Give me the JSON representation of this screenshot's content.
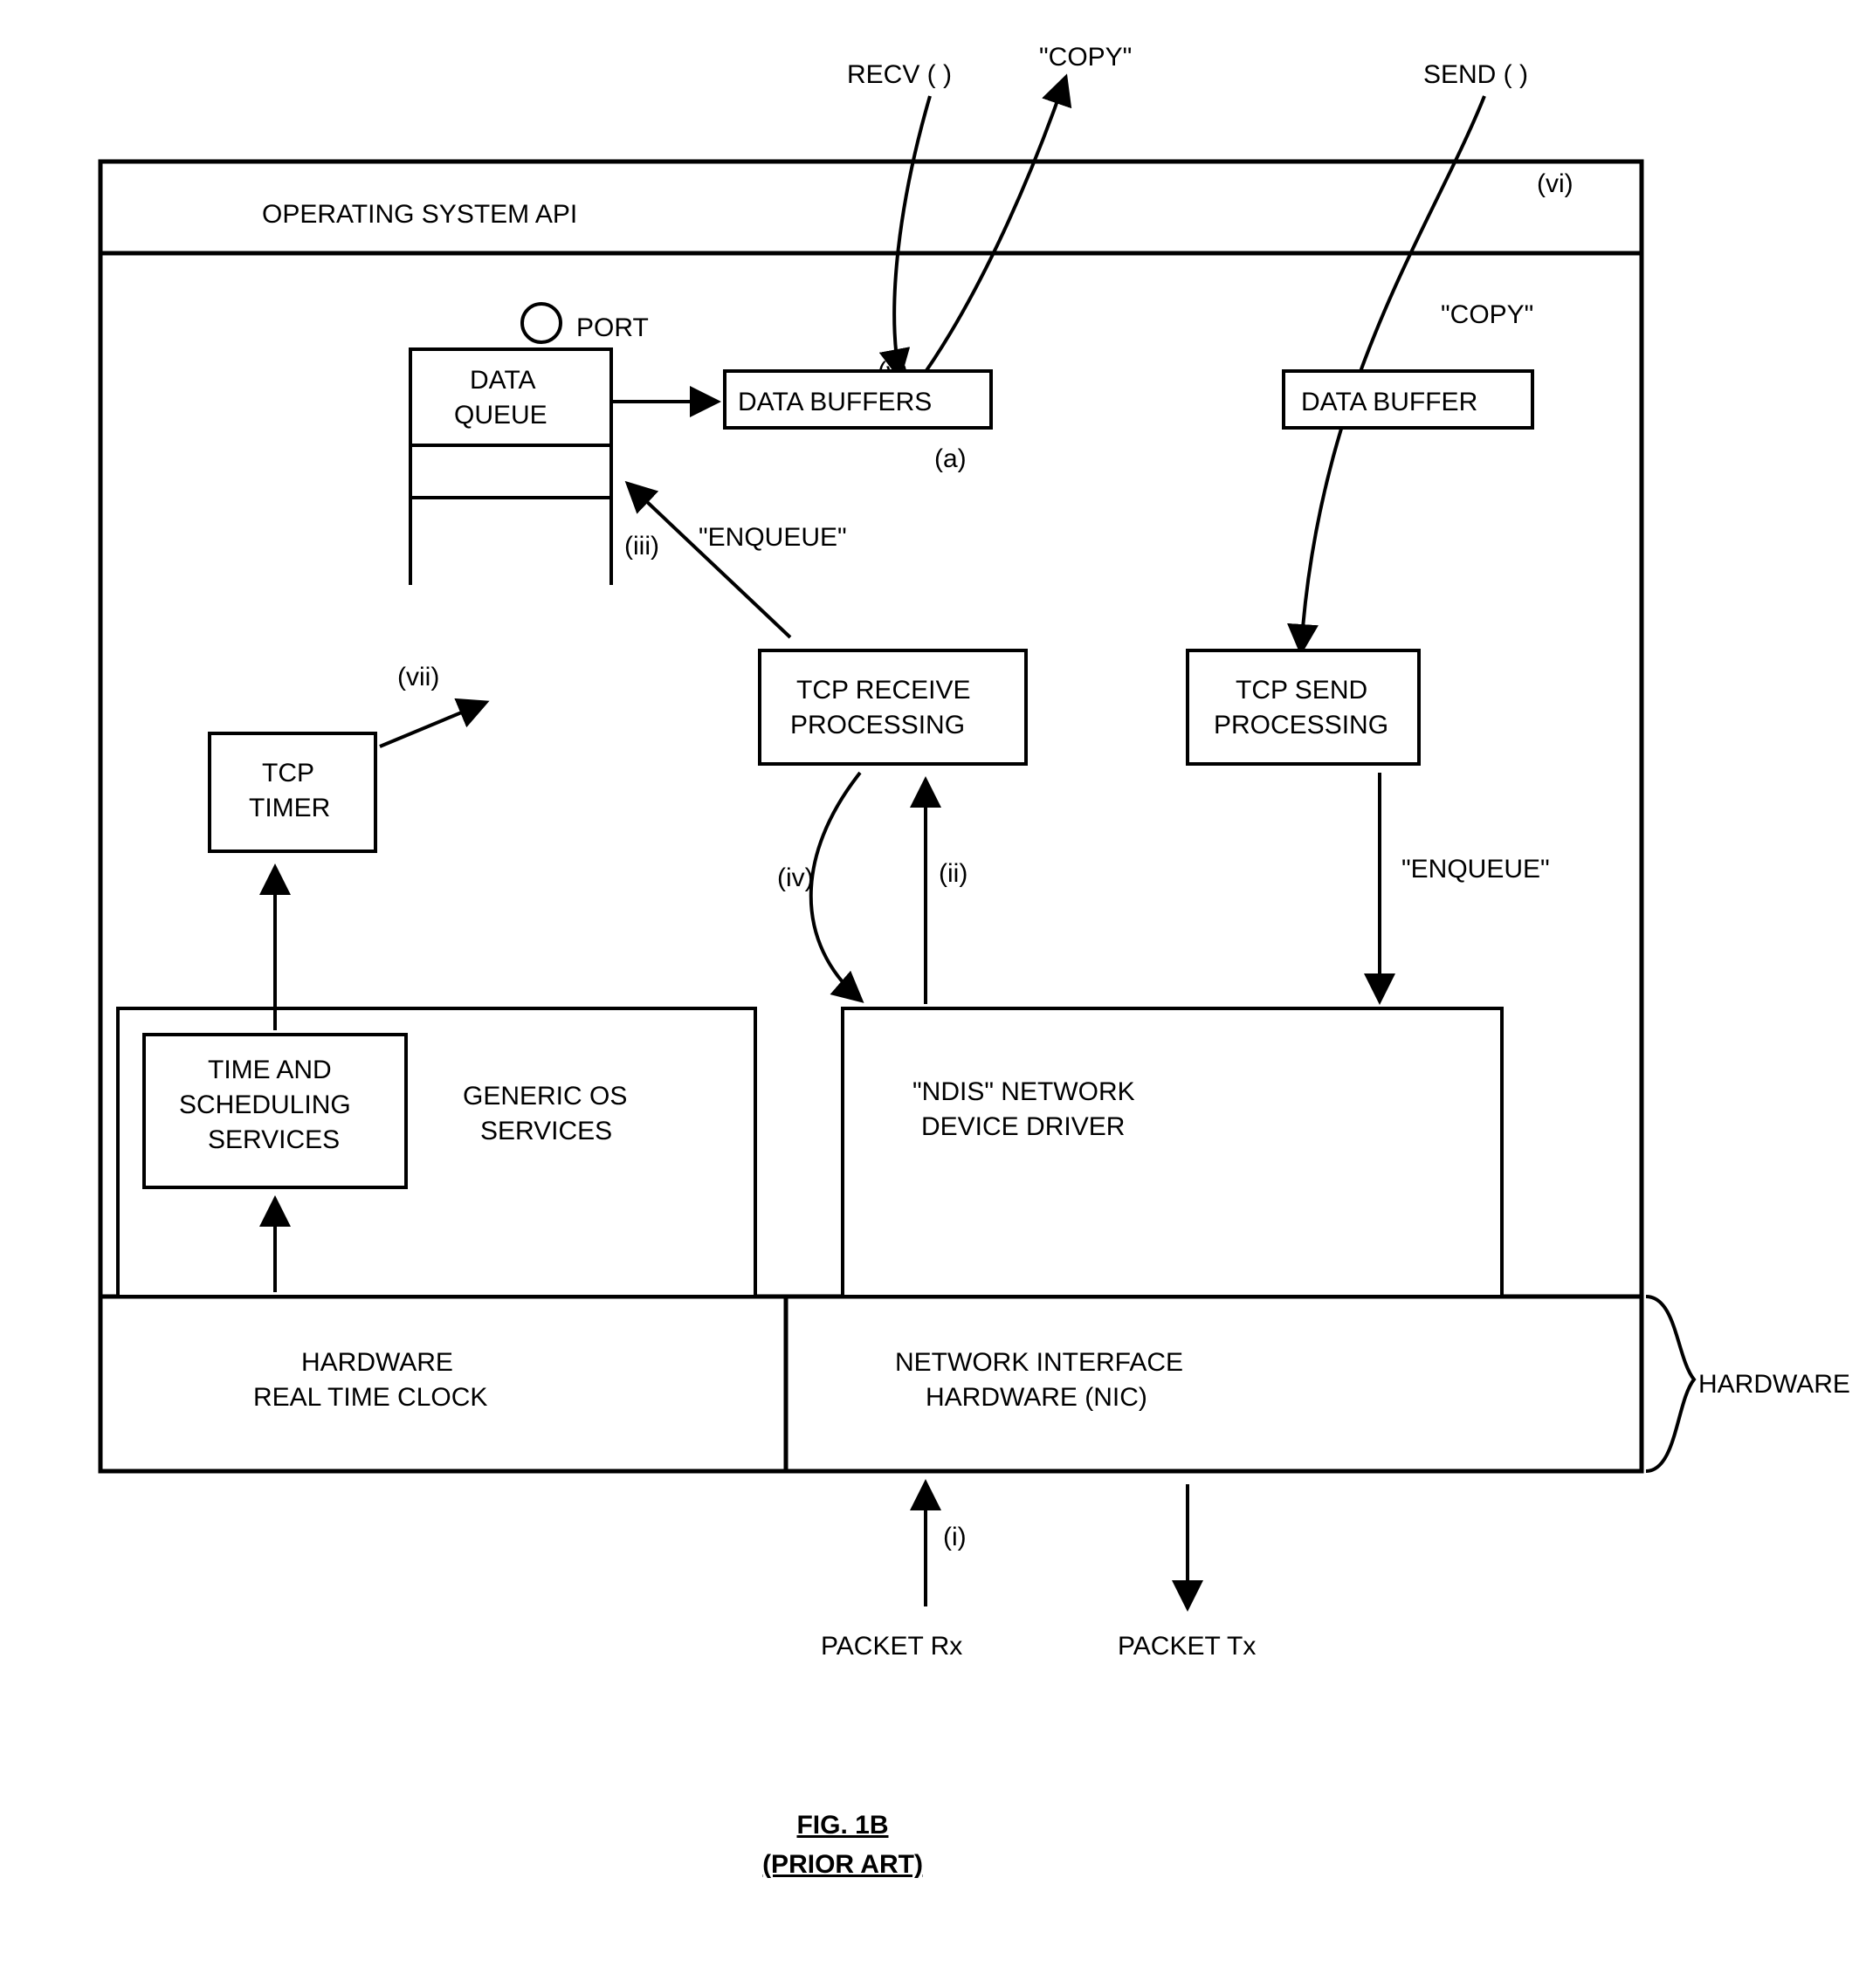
{
  "top": {
    "recv": "RECV ( )",
    "copy_recv": "\"COPY\"",
    "send": "SEND ( )",
    "marker_vi": "(vi)",
    "copy_send": "\"COPY\""
  },
  "api_band": "OPERATING SYSTEM API",
  "port": {
    "label": "PORT",
    "data_queue": "DATA\nQUEUE",
    "data_buffers": "DATA BUFFERS",
    "marker_a": "(a)"
  },
  "data_buffer_right": "DATA BUFFER",
  "enqueue_recv": {
    "text": "\"ENQUEUE\"",
    "marker": "(iii)"
  },
  "marker_v": "(v)",
  "tcp_receive": "TCP RECEIVE\nPROCESSING",
  "tcp_send": "TCP SEND\nPROCESSING",
  "tcp_timer": {
    "label": "TCP\nTIMER",
    "marker": "(vii)"
  },
  "marker_iv": "(iv)",
  "marker_ii": "(ii)",
  "enqueue_send": "\"ENQUEUE\"",
  "generic_os": {
    "time_sched": "TIME AND\nSCHEDULING\nSERVICES",
    "label": "GENERIC OS\nSERVICES"
  },
  "ndis": "\"NDIS\" NETWORK\nDEVICE DRIVER",
  "hw_clock": "HARDWARE\nREAL TIME CLOCK",
  "nic": "NETWORK INTERFACE\nHARDWARE (NIC)",
  "hardware_brace": "HARDWARE",
  "bottom": {
    "marker_i": "(i)",
    "rx": "PACKET Rx",
    "tx": "PACKET Tx"
  },
  "caption": {
    "fig": "FIG. 1B",
    "prior": "(PRIOR ART)"
  }
}
